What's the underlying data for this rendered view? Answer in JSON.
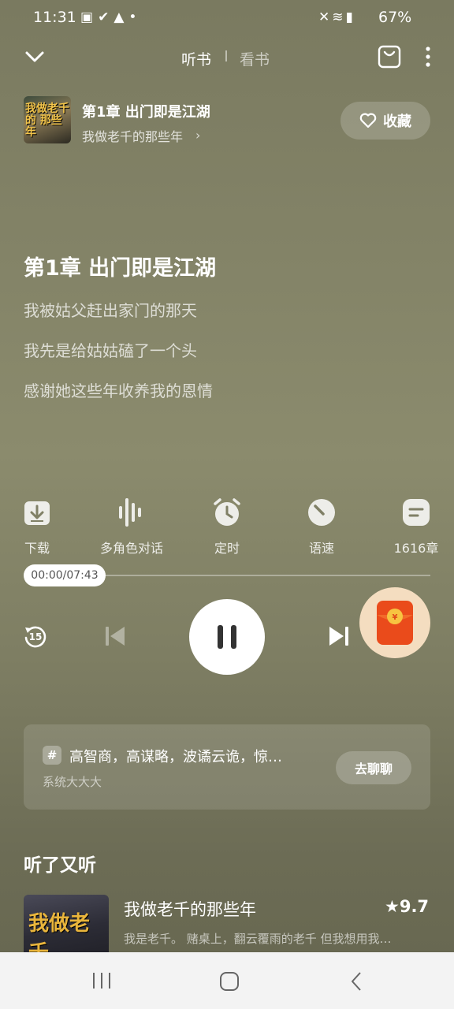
{
  "status_bar": {
    "time": "11:31",
    "left_icons": [
      "gallery-icon",
      "check-icon",
      "warning-icon",
      "dot-icon"
    ],
    "right_icons": [
      "mute-icon",
      "wifi-icon",
      "signal-icon"
    ],
    "battery": "67%"
  },
  "header": {
    "tabs": [
      {
        "label": "听书",
        "active": true
      },
      {
        "label": "看书",
        "active": false
      }
    ]
  },
  "book": {
    "chapter_title": "第1章 出门即是江湖",
    "name": "我做老千的那些年",
    "cover_text": "我做老千的 那些年",
    "collect_label": "收藏"
  },
  "content": {
    "heading": "第1章 出门即是江湖",
    "lines": [
      "我被姑父赶出家门的那天",
      "我先是给姑姑磕了一个头",
      "感谢她这些年收养我的恩情"
    ]
  },
  "functions": [
    {
      "label": "下载",
      "icon": "download-icon"
    },
    {
      "label": "多角色对话",
      "icon": "voice-wave-icon"
    },
    {
      "label": "定时",
      "icon": "alarm-clock-icon"
    },
    {
      "label": "语速",
      "icon": "speed-gauge-icon"
    },
    {
      "label": "1616章",
      "icon": "chapter-list-icon"
    }
  ],
  "player": {
    "time_display": "00:00/07:43",
    "progress": 0.0,
    "rewind_label": "15"
  },
  "chat_card": {
    "title": "高智商，高谋略，波谲云诡，惊…",
    "subtitle": "系统大大大",
    "button": "去聊聊"
  },
  "recommend": {
    "section_title": "听了又听",
    "items": [
      {
        "title": "我做老千的那些年",
        "score": "9.7",
        "desc": "我是老千。 赌桌上，翻云覆雨的老千 但我想用我…",
        "cover_text": "我做老千"
      }
    ]
  },
  "colors": {
    "background": "#838367",
    "accent": "#ffffff"
  }
}
